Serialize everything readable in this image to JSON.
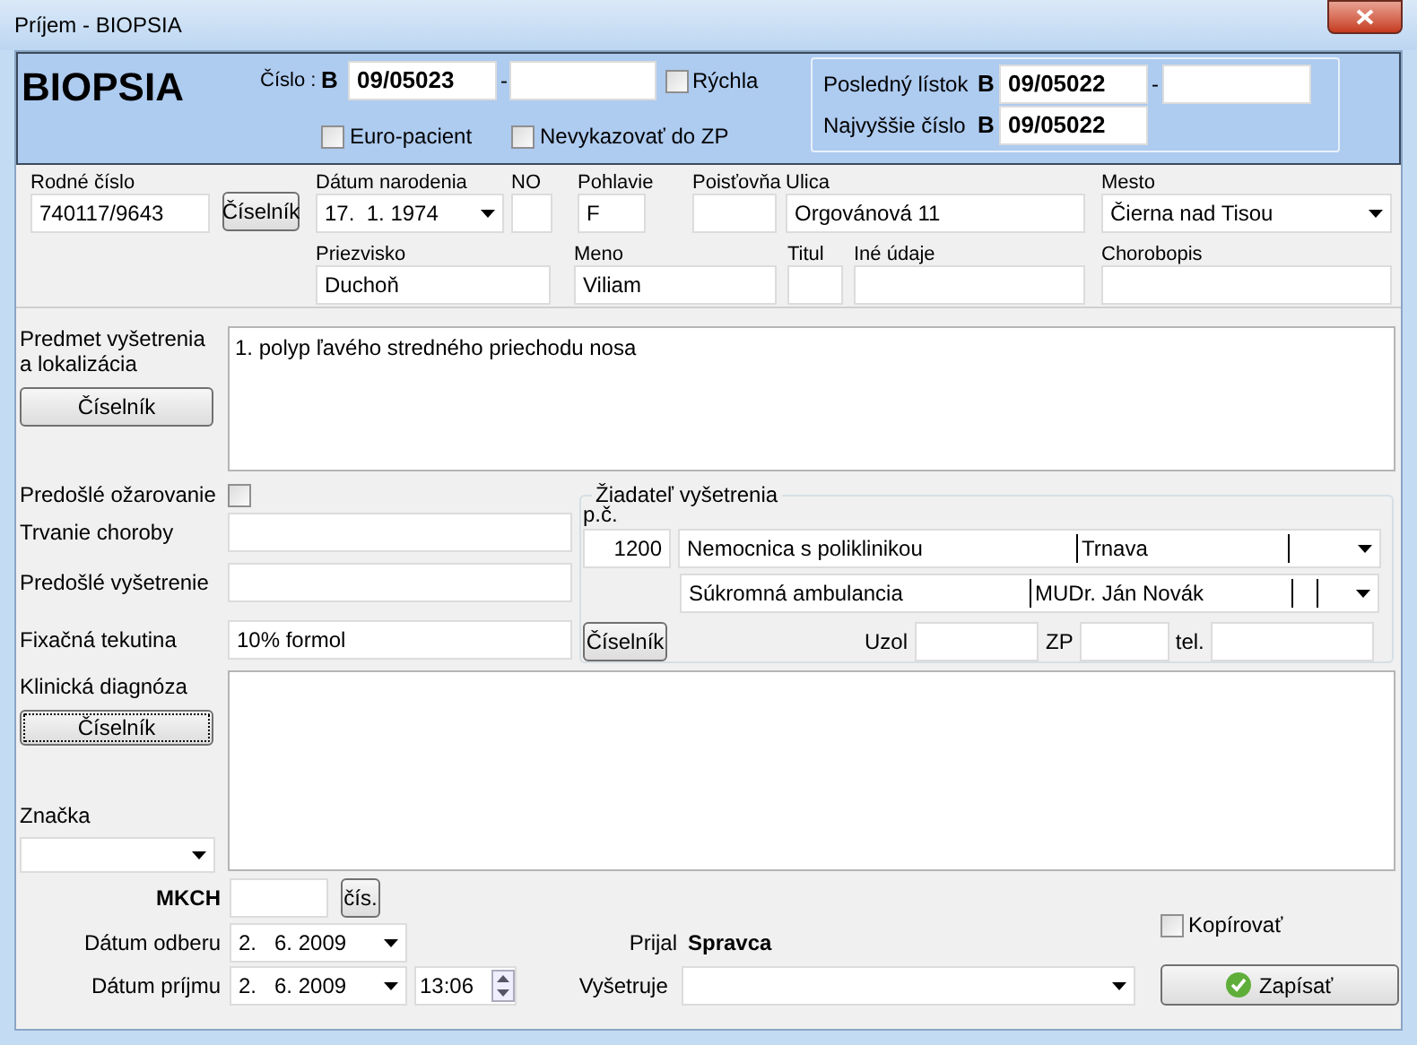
{
  "window": {
    "title": "Príjem - BIOPSIA"
  },
  "header": {
    "form_title": "BIOPSIA",
    "number_label": "Číslo :",
    "series": "B",
    "number": "09/05023",
    "separator": "-",
    "checkboxes": [
      {
        "label": "Rýchla",
        "checked": false
      },
      {
        "label": "Euro-pacient",
        "checked": false
      },
      {
        "label": "Nevykazovať do ZP",
        "checked": false
      }
    ],
    "last": [
      {
        "label": "Posledný lístok",
        "series": "B",
        "value": "09/05022",
        "separator": "-"
      },
      {
        "label": "Najvyššie číslo",
        "series": "B",
        "value": "09/05022"
      }
    ]
  },
  "patient": {
    "row_1": [
      {
        "kind": "text",
        "label": "Rodné číslo",
        "value": "740117/9643"
      },
      {
        "kind": "button",
        "text": "Číselník"
      },
      {
        "kind": "combo",
        "label": "Dátum narodenia",
        "value": "17.  1. 1974"
      },
      {
        "kind": "text",
        "label": "NO"
      },
      {
        "kind": "text",
        "label": "Pohlavie",
        "value": "F"
      },
      {
        "kind": "text",
        "label": "Poisťovňa"
      },
      {
        "kind": "text",
        "label": "Ulica",
        "value": "Orgovánová 11"
      },
      {
        "kind": "combo",
        "label": "Mesto",
        "value": "Čierna nad Tisou"
      }
    ],
    "row_2": [
      {
        "label": "Priezvisko",
        "value": "Duchoň"
      },
      {
        "label": "Meno",
        "value": "Viliam"
      },
      {
        "label": "Titul"
      },
      {
        "label": "Iné údaje"
      },
      {
        "label": "Chorobopis"
      }
    ]
  },
  "subject": {
    "label": "Predmet vyšetrenia a lokalizácia",
    "button": "Číselník",
    "value": "1. polyp ľavého stredného priechodu nosa"
  },
  "history": {
    "irradiation": {
      "label": "Predošlé ožarovanie",
      "checked": false
    },
    "fields": [
      {
        "label": "Trvanie choroby"
      },
      {
        "label": "Predošlé vyšetrenie"
      },
      {
        "label": "Fixačná tekutina",
        "value": "10% formol"
      }
    ]
  },
  "requester": {
    "title": "Žiadateľ vyšetrenia",
    "number_label": "p.č.",
    "number": "1200",
    "rows": [
      {
        "parts": [
          "Nemocnica s poliklinikou",
          "Trnava"
        ]
      },
      {
        "parts": [
          "Súkromná ambulancia",
          "MUDr. Ján Novák"
        ]
      }
    ],
    "button": "Číselník",
    "contacts": [
      {
        "label": "Uzol"
      },
      {
        "label": "ZP"
      },
      {
        "label": "tel."
      }
    ]
  },
  "diagnosis": {
    "label": "Klinická diagnóza",
    "button": "Číselník",
    "focused": true
  },
  "mark": {
    "label": "Značka"
  },
  "footer": {
    "mkch": {
      "label": "MKCH",
      "button": "čís."
    },
    "sampling_date": {
      "label": "Dátum odberu",
      "value": "2.   6. 2009"
    },
    "receipt_date": {
      "label": "Dátum príjmu",
      "value": "2.   6. 2009",
      "time": "13:06"
    },
    "received_by": {
      "label": "Prijal",
      "value": "Spravca"
    },
    "examiner": {
      "label": "Vyšetruje"
    },
    "copy": {
      "label": "Kopírovať",
      "checked": false
    },
    "save_button": "Zapísať"
  }
}
